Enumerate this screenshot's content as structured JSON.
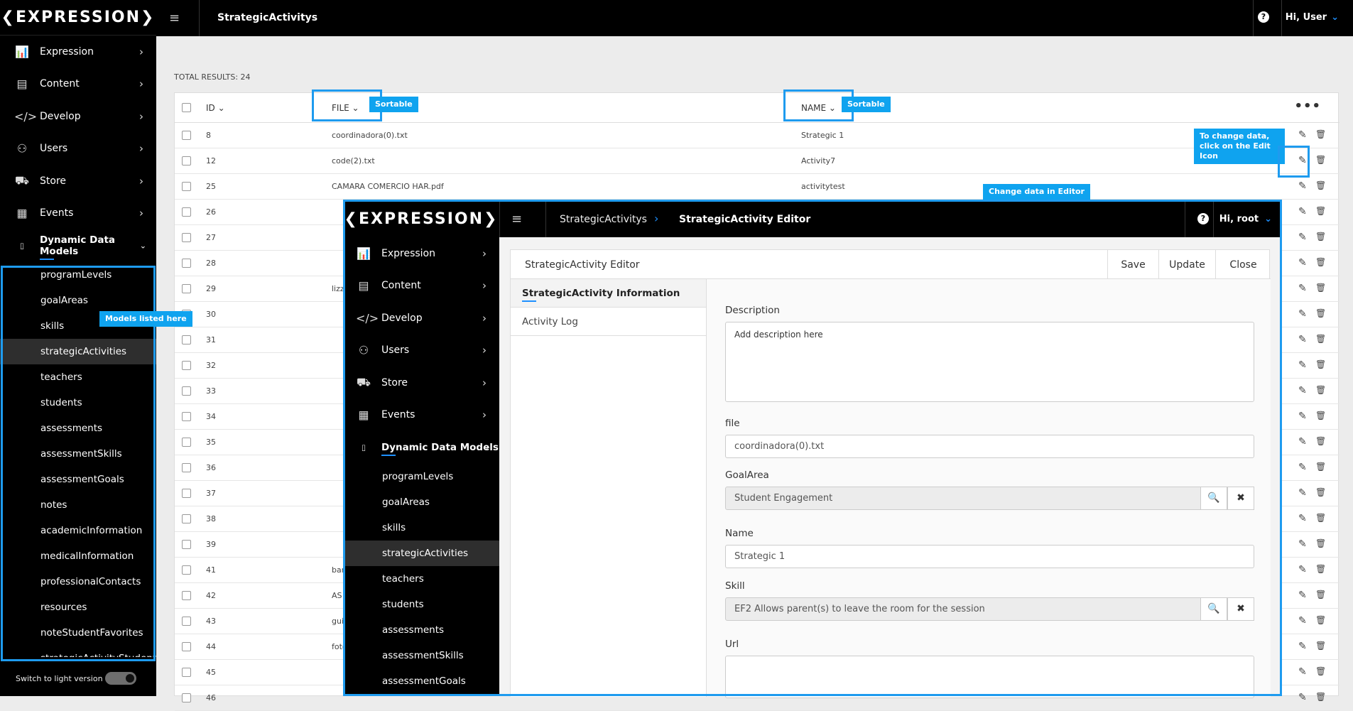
{
  "brand": "❮EXPRESSION❯",
  "topbar": {
    "title": "StrategicActivitys",
    "help_glyph": "?",
    "user": "Hi, User"
  },
  "nav": {
    "items": [
      {
        "label": "Expression",
        "icon": "bar-chart-icon",
        "glyph": "📊"
      },
      {
        "label": "Content",
        "icon": "document-icon",
        "glyph": "▤"
      },
      {
        "label": "Develop",
        "icon": "code-icon",
        "glyph": "</>"
      },
      {
        "label": "Users",
        "icon": "user-icon",
        "glyph": "⚇"
      },
      {
        "label": "Store",
        "icon": "cart-icon",
        "glyph": "⛟"
      },
      {
        "label": "Events",
        "icon": "calendar-icon",
        "glyph": "▦"
      }
    ],
    "ddm": "Dynamic Data Models",
    "models": [
      "programLevels",
      "goalAreas",
      "skills",
      "strategicActivities",
      "teachers",
      "students",
      "assessments",
      "assessmentSkills",
      "assessmentGoals",
      "notes",
      "academicInformation",
      "medicalInformation",
      "professionalContacts",
      "resources",
      "noteStudentFavorites",
      "strategicActivityStudent"
    ],
    "active_model": "strategicActivities",
    "toggle_label": "Switch to light version"
  },
  "callouts": {
    "sortable": "Sortable",
    "models": "Models listed here",
    "edit": "To change data, click on the Edit Icon",
    "editor": "Change data in Editor"
  },
  "grid": {
    "total": "TOTAL RESULTS: 24",
    "headers": {
      "id": "ID ⌄",
      "file": "FILE ⌄",
      "name": "NAME ⌄"
    },
    "more": "•••",
    "rows": [
      {
        "id": "8",
        "file": "coordinadora(0).txt",
        "name": "Strategic 1"
      },
      {
        "id": "12",
        "file": "code(2).txt",
        "name": "Activity7"
      },
      {
        "id": "25",
        "file": "CAMARA COMERCIO HAR.pdf",
        "name": "activitytest"
      },
      {
        "id": "26",
        "file": "",
        "name": ""
      },
      {
        "id": "27",
        "file": "",
        "name": ""
      },
      {
        "id": "28",
        "file": "",
        "name": ""
      },
      {
        "id": "29",
        "file": "lizz",
        "name": ""
      },
      {
        "id": "30",
        "file": "",
        "name": ""
      },
      {
        "id": "31",
        "file": "",
        "name": ""
      },
      {
        "id": "32",
        "file": "",
        "name": ""
      },
      {
        "id": "33",
        "file": "",
        "name": ""
      },
      {
        "id": "34",
        "file": "",
        "name": ""
      },
      {
        "id": "35",
        "file": "",
        "name": ""
      },
      {
        "id": "36",
        "file": "",
        "name": ""
      },
      {
        "id": "37",
        "file": "",
        "name": ""
      },
      {
        "id": "38",
        "file": "",
        "name": ""
      },
      {
        "id": "39",
        "file": "",
        "name": ""
      },
      {
        "id": "41",
        "file": "bar",
        "name": ""
      },
      {
        "id": "42",
        "file": "AS",
        "name": ""
      },
      {
        "id": "43",
        "file": "gui",
        "name": ""
      },
      {
        "id": "44",
        "file": "foto",
        "name": ""
      },
      {
        "id": "45",
        "file": "",
        "name": ""
      },
      {
        "id": "46",
        "file": "",
        "name": ""
      }
    ],
    "edit_glyph": "✎",
    "delete_glyph": "🗑"
  },
  "editor": {
    "crumb1": "StrategicActivitys",
    "crumb_sep": "›",
    "crumb2": "StrategicActivity Editor",
    "user": "Hi, root",
    "nav_models": [
      "programLevels",
      "goalAreas",
      "skills",
      "strategicActivities",
      "teachers",
      "students",
      "assessments",
      "assessmentSkills",
      "assessmentGoals"
    ],
    "panel_title": "StrategicActivity Editor",
    "buttons": {
      "save": "Save",
      "update": "Update",
      "close": "Close"
    },
    "tabs": [
      "StrategicActivity Information",
      "Activity Log"
    ],
    "fields": {
      "description_label": "Description",
      "description_value": "Add description here",
      "file_label": "file",
      "file_value": "coordinadora(0).txt",
      "goalarea_label": "GoalArea",
      "goalarea_value": "Student Engagement",
      "name_label": "Name",
      "name_value": "Strategic 1",
      "skill_label": "Skill",
      "skill_value": "EF2 Allows parent(s) to leave the room for the session",
      "url_label": "Url",
      "url_value": ""
    },
    "search_glyph": "🔍",
    "clear_glyph": "✖"
  },
  "colors": {
    "accent": "#1e90ff",
    "callout": "#0fa3ef",
    "highlight": "#1e9bef"
  }
}
